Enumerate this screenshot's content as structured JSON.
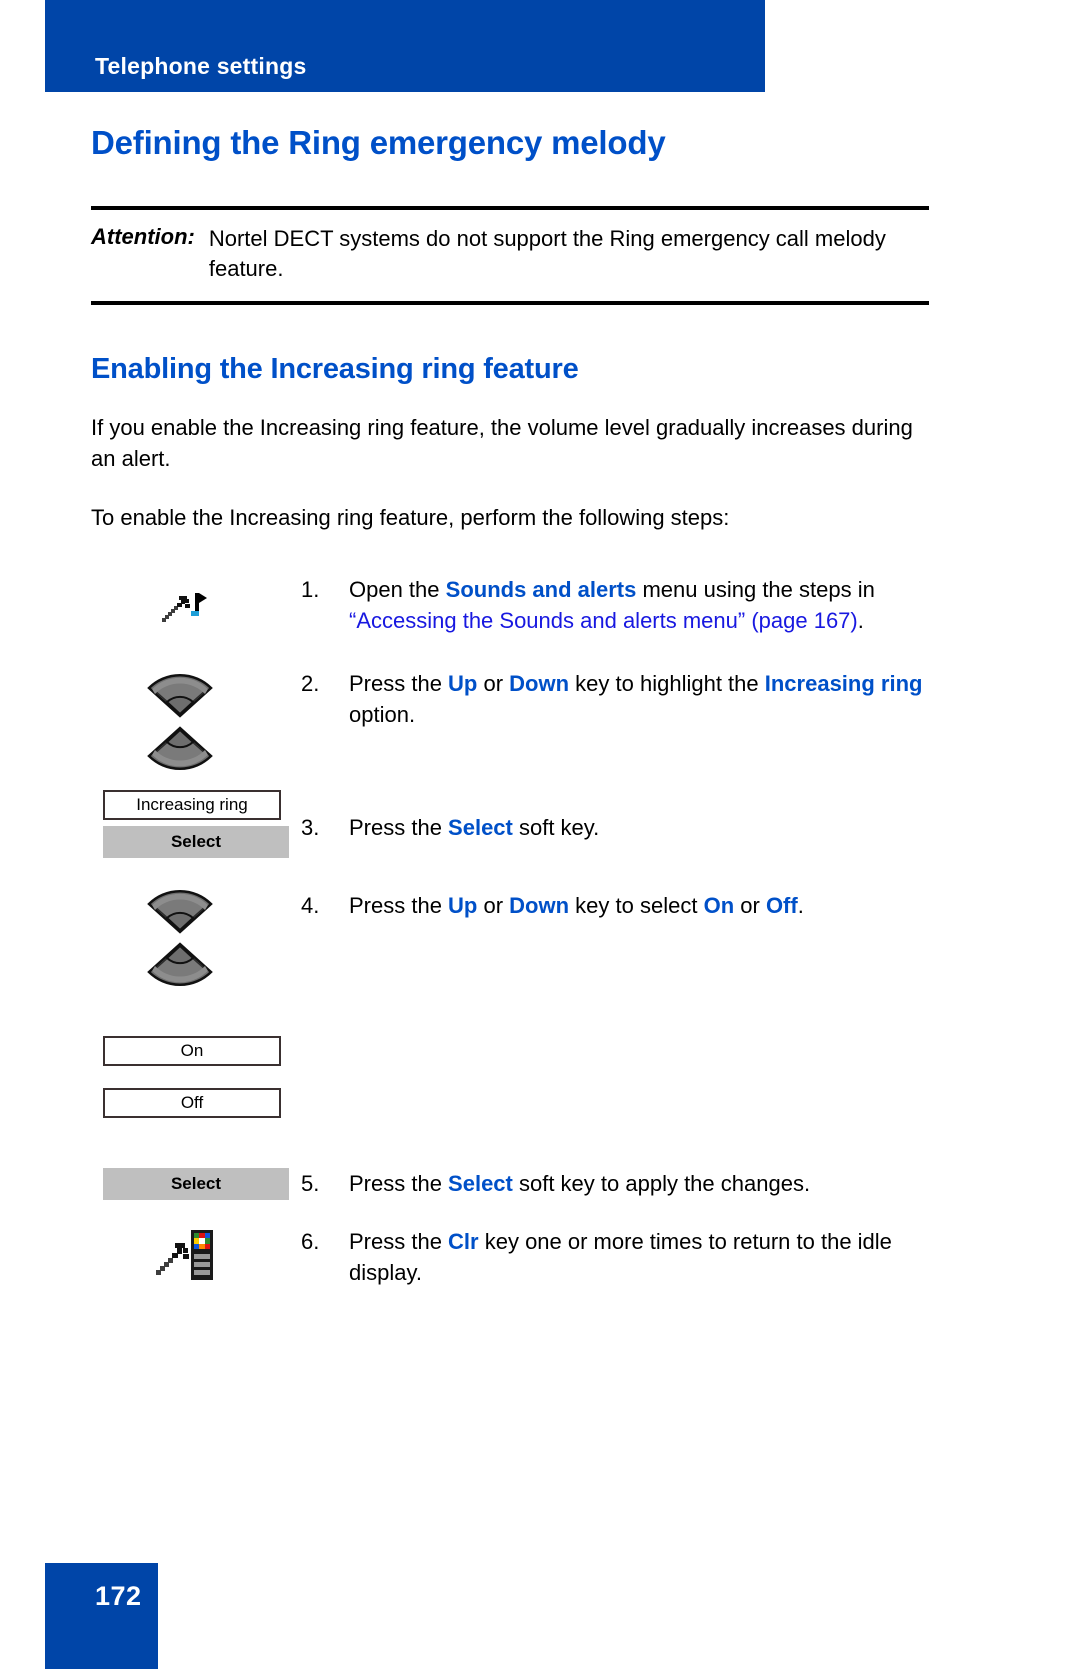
{
  "header": {
    "section_title": "Telephone settings",
    "banner_color": "#0045a8"
  },
  "headings": {
    "h1": "Defining the Ring emergency melody",
    "h2": "Enabling the Increasing ring feature",
    "heading_color": "#0050c8"
  },
  "attention": {
    "label": "Attention:",
    "text": "Nortel DECT systems do not support the Ring emergency call melody feature."
  },
  "intro": {
    "paragraph_1": "If you enable the Increasing ring feature, the volume level gradually increases during an alert.",
    "paragraph_2": "To enable the Increasing ring feature, perform the following steps:"
  },
  "steps": [
    {
      "number": "1.",
      "icon": "sounds-and-alerts-menu-icon",
      "text_parts": [
        {
          "t": "Open the ",
          "style": "plain"
        },
        {
          "t": "Sounds and alerts",
          "style": "keyword"
        },
        {
          "t": " menu using the steps in ",
          "style": "plain"
        },
        {
          "t": "“Accessing the Sounds and alerts menu” (page 167)",
          "style": "xref"
        },
        {
          "t": ".",
          "style": "plain"
        }
      ]
    },
    {
      "number": "2.",
      "icon": "navigation-up-down-keys-icon",
      "text_parts": [
        {
          "t": "Press the ",
          "style": "plain"
        },
        {
          "t": "Up",
          "style": "keyword"
        },
        {
          "t": " or ",
          "style": "plain"
        },
        {
          "t": "Down",
          "style": "keyword"
        },
        {
          "t": " key to highlight the ",
          "style": "plain"
        },
        {
          "t": "Increasing ring",
          "style": "keyword"
        },
        {
          "t": " option.",
          "style": "plain"
        }
      ]
    },
    {
      "number": "3.",
      "icon": "display-increasing-ring-and-select-softkey",
      "text_parts": [
        {
          "t": "Press the ",
          "style": "plain"
        },
        {
          "t": "Select",
          "style": "keyword"
        },
        {
          "t": " soft key.",
          "style": "plain"
        }
      ]
    },
    {
      "number": "4.",
      "icon": "navigation-up-down-keys-icon",
      "text_parts": [
        {
          "t": "Press the ",
          "style": "plain"
        },
        {
          "t": "Up",
          "style": "keyword"
        },
        {
          "t": " or ",
          "style": "plain"
        },
        {
          "t": "Down",
          "style": "keyword"
        },
        {
          "t": " key to select ",
          "style": "plain"
        },
        {
          "t": "On",
          "style": "keyword"
        },
        {
          "t": " or ",
          "style": "plain"
        },
        {
          "t": "Off",
          "style": "keyword"
        },
        {
          "t": ".",
          "style": "plain"
        }
      ]
    },
    {
      "number": "5.",
      "icon": "select-softkey",
      "text_parts": [
        {
          "t": "Press the ",
          "style": "plain"
        },
        {
          "t": "Select",
          "style": "keyword"
        },
        {
          "t": " soft key to apply the changes.",
          "style": "plain"
        }
      ]
    },
    {
      "number": "6.",
      "icon": "clr-key-idle-display-icon",
      "text_parts": [
        {
          "t": "Press the ",
          "style": "plain"
        },
        {
          "t": "Clr",
          "style": "keyword"
        },
        {
          "t": " key one or more times to return to the idle display.",
          "style": "plain"
        }
      ]
    }
  ],
  "display_boxes": {
    "increasing_ring": "Increasing ring",
    "select_softkey": "Select",
    "on": "On",
    "off": "Off",
    "select_softkey_5": "Select"
  },
  "footer": {
    "page_number": "172",
    "box_color": "#0045a8"
  }
}
